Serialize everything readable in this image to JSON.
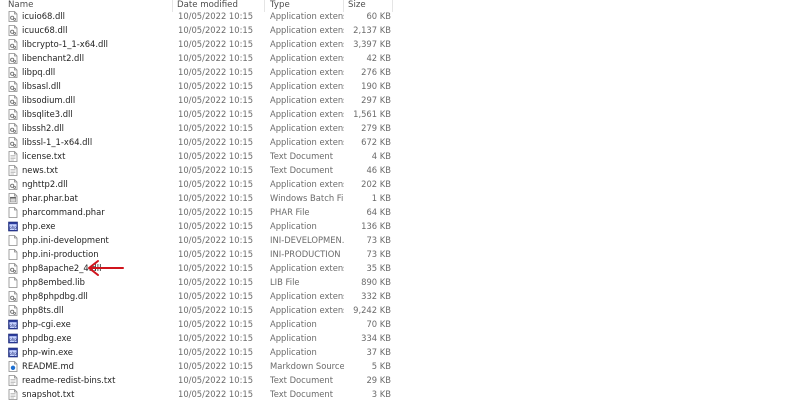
{
  "columns": {
    "name": "Name",
    "date": "Date modified",
    "type": "Type",
    "size": "Size"
  },
  "accent_color": "#d0141c",
  "files": [
    {
      "name": "icuio68.dll",
      "date": "10/05/2022 10:15",
      "type": "Application extens...",
      "size": "60 KB",
      "icon": "dll-file-icon"
    },
    {
      "name": "icuuc68.dll",
      "date": "10/05/2022 10:15",
      "type": "Application extens...",
      "size": "2,137 KB",
      "icon": "dll-file-icon"
    },
    {
      "name": "libcrypto-1_1-x64.dll",
      "date": "10/05/2022 10:15",
      "type": "Application extens...",
      "size": "3,397 KB",
      "icon": "dll-file-icon"
    },
    {
      "name": "libenchant2.dll",
      "date": "10/05/2022 10:15",
      "type": "Application extens...",
      "size": "42 KB",
      "icon": "dll-file-icon"
    },
    {
      "name": "libpq.dll",
      "date": "10/05/2022 10:15",
      "type": "Application extens...",
      "size": "276 KB",
      "icon": "dll-file-icon"
    },
    {
      "name": "libsasl.dll",
      "date": "10/05/2022 10:15",
      "type": "Application extens...",
      "size": "190 KB",
      "icon": "dll-file-icon"
    },
    {
      "name": "libsodium.dll",
      "date": "10/05/2022 10:15",
      "type": "Application extens...",
      "size": "297 KB",
      "icon": "dll-file-icon"
    },
    {
      "name": "libsqlite3.dll",
      "date": "10/05/2022 10:15",
      "type": "Application extens...",
      "size": "1,561 KB",
      "icon": "dll-file-icon"
    },
    {
      "name": "libssh2.dll",
      "date": "10/05/2022 10:15",
      "type": "Application extens...",
      "size": "279 KB",
      "icon": "dll-file-icon"
    },
    {
      "name": "libssl-1_1-x64.dll",
      "date": "10/05/2022 10:15",
      "type": "Application extens...",
      "size": "672 KB",
      "icon": "dll-file-icon"
    },
    {
      "name": "license.txt",
      "date": "10/05/2022 10:15",
      "type": "Text Document",
      "size": "4 KB",
      "icon": "text-file-icon"
    },
    {
      "name": "news.txt",
      "date": "10/05/2022 10:15",
      "type": "Text Document",
      "size": "46 KB",
      "icon": "text-file-icon"
    },
    {
      "name": "nghttp2.dll",
      "date": "10/05/2022 10:15",
      "type": "Application extens...",
      "size": "202 KB",
      "icon": "dll-file-icon"
    },
    {
      "name": "phar.phar.bat",
      "date": "10/05/2022 10:15",
      "type": "Windows Batch File",
      "size": "1 KB",
      "icon": "batch-file-icon"
    },
    {
      "name": "pharcommand.phar",
      "date": "10/05/2022 10:15",
      "type": "PHAR File",
      "size": "64 KB",
      "icon": "blank-file-icon"
    },
    {
      "name": "php.exe",
      "date": "10/05/2022 10:15",
      "type": "Application",
      "size": "136 KB",
      "icon": "exe-file-icon"
    },
    {
      "name": "php.ini-development",
      "date": "10/05/2022 10:15",
      "type": "INI-DEVELOPMEN...",
      "size": "73 KB",
      "icon": "blank-file-icon"
    },
    {
      "name": "php.ini-production",
      "date": "10/05/2022 10:15",
      "type": "INI-PRODUCTION ...",
      "size": "73 KB",
      "icon": "blank-file-icon"
    },
    {
      "name": "php8apache2_4.dll",
      "date": "10/05/2022 10:15",
      "type": "Application extens...",
      "size": "35 KB",
      "icon": "dll-file-icon"
    },
    {
      "name": "php8embed.lib",
      "date": "10/05/2022 10:15",
      "type": "LIB File",
      "size": "890 KB",
      "icon": "blank-file-icon"
    },
    {
      "name": "php8phpdbg.dll",
      "date": "10/05/2022 10:15",
      "type": "Application extens...",
      "size": "332 KB",
      "icon": "dll-file-icon"
    },
    {
      "name": "php8ts.dll",
      "date": "10/05/2022 10:15",
      "type": "Application extens...",
      "size": "9,242 KB",
      "icon": "dll-file-icon"
    },
    {
      "name": "php-cgi.exe",
      "date": "10/05/2022 10:15",
      "type": "Application",
      "size": "70 KB",
      "icon": "exe-file-icon"
    },
    {
      "name": "phpdbg.exe",
      "date": "10/05/2022 10:15",
      "type": "Application",
      "size": "334 KB",
      "icon": "exe-file-icon"
    },
    {
      "name": "php-win.exe",
      "date": "10/05/2022 10:15",
      "type": "Application",
      "size": "37 KB",
      "icon": "exe-file-icon"
    },
    {
      "name": "README.md",
      "date": "10/05/2022 10:15",
      "type": "Markdown Source ...",
      "size": "5 KB",
      "icon": "markdown-file-icon"
    },
    {
      "name": "readme-redist-bins.txt",
      "date": "10/05/2022 10:15",
      "type": "Text Document",
      "size": "29 KB",
      "icon": "text-file-icon"
    },
    {
      "name": "snapshot.txt",
      "date": "10/05/2022 10:15",
      "type": "Text Document",
      "size": "3 KB",
      "icon": "text-file-icon"
    }
  ]
}
